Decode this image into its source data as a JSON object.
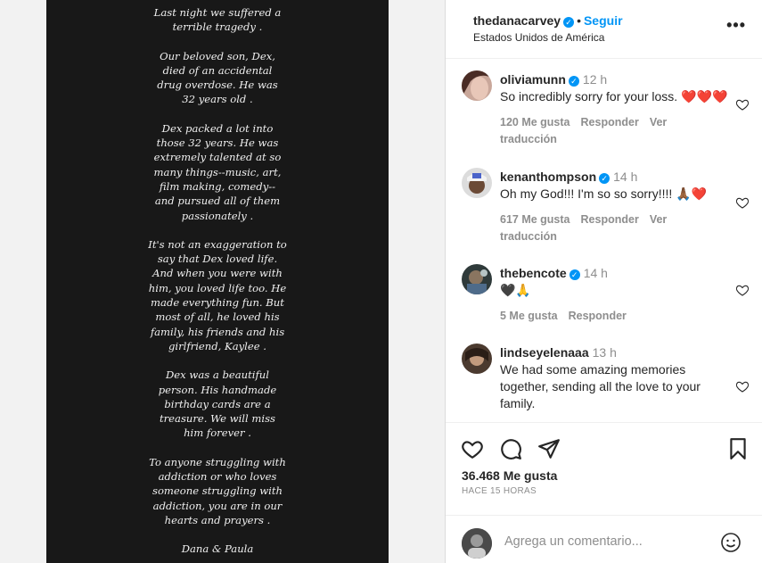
{
  "post": {
    "text_lines": [
      "Last night we suffered a terrible tragedy .",
      "Our beloved son, Dex, died of an accidental drug overdose. He was 32 years old .",
      "Dex packed a lot into those 32 years. He was extremely talented at so many things--music, art, film making, comedy--and pursued all of them passionately .",
      "It's not an exaggeration to say that Dex loved life. And when you were with him, you loved life too. He made everything fun. But most of all, he loved his family, his friends and his girlfriend, Kaylee .",
      "Dex was a beautiful person. His handmade birthday cards are a treasure. We will miss him forever .",
      "To anyone struggling with addiction or who loves someone struggling with addiction, you are in our hearts and prayers .",
      "Dana & Paula"
    ]
  },
  "header": {
    "username": "thedanacarvey",
    "separator": "•",
    "follow_label": "Seguir",
    "location": "Estados Unidos de América",
    "more_label": "•••"
  },
  "comments": [
    {
      "username": "oliviamunn",
      "verified": true,
      "time": "12 h",
      "text": "So incredibly sorry for your loss.",
      "emoji": "❤️❤️❤️",
      "likes": "120 Me gusta",
      "reply": "Responder",
      "translate": "Ver traducción"
    },
    {
      "username": "kenanthompson",
      "verified": true,
      "time": "14 h",
      "text": "Oh my God!!! I'm so so sorry!!!!",
      "emoji": "🙏🏾❤️",
      "likes": "617 Me gusta",
      "reply": "Responder",
      "translate": "Ver traducción"
    },
    {
      "username": "thebencote",
      "verified": true,
      "time": "14 h",
      "text": "",
      "emoji": "🖤🙏",
      "likes": "5 Me gusta",
      "reply": "Responder",
      "translate": ""
    },
    {
      "username": "lindseyelenaaa",
      "verified": false,
      "time": "13 h",
      "text": "We had some amazing memories together, sending all the love to your family.",
      "emoji": "",
      "likes": "",
      "reply": "",
      "translate": ""
    }
  ],
  "actions": {
    "likes_count": "36.468 Me gusta",
    "time_ago": "HACE 15 HORAS",
    "comment_placeholder": "Agrega un comentario..."
  },
  "colors": {
    "accent": "#0095f6",
    "muted": "#8e8e8e",
    "text": "#262626",
    "heart": "#e0245e",
    "post_bg": "#181818"
  }
}
